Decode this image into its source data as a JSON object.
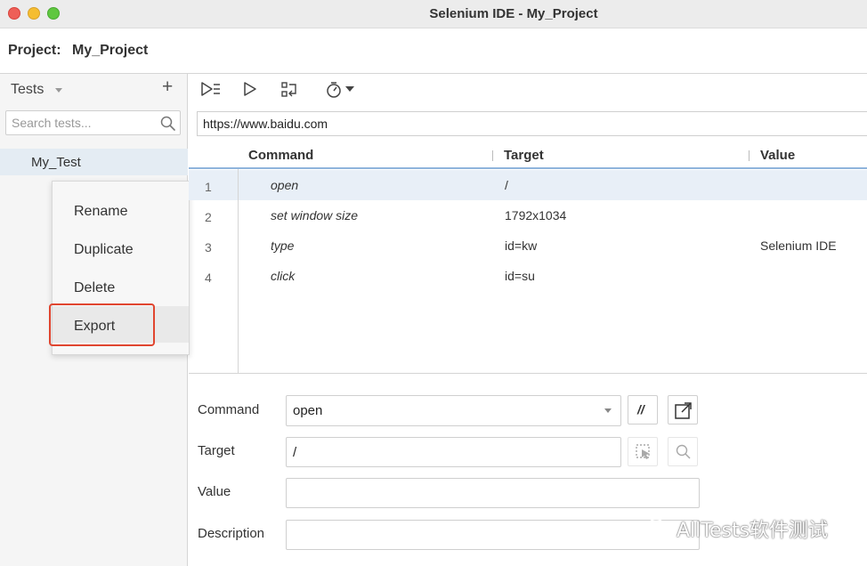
{
  "window": {
    "title": "Selenium IDE - My_Project"
  },
  "project": {
    "label": "Project:",
    "name": "My_Project"
  },
  "sidebar": {
    "title": "Tests",
    "search_placeholder": "Search tests...",
    "tests": [
      {
        "name": "My_Test"
      }
    ]
  },
  "context_menu": {
    "items": [
      "Rename",
      "Duplicate",
      "Delete",
      "Export"
    ],
    "highlighted": "Export"
  },
  "toolbar": {
    "icons": [
      "run-all-tests-icon",
      "run-current-test-icon",
      "step-over-icon",
      "test-execution-speed-icon"
    ]
  },
  "url": {
    "value": "https://www.baidu.com"
  },
  "table": {
    "headers": {
      "command": "Command",
      "target": "Target",
      "value": "Value"
    },
    "rows": [
      {
        "num": "1",
        "command": "open",
        "target": "/",
        "value": ""
      },
      {
        "num": "2",
        "command": "set window size",
        "target": "1792x1034",
        "value": ""
      },
      {
        "num": "3",
        "command": "type",
        "target": "id=kw",
        "value": "Selenium IDE"
      },
      {
        "num": "4",
        "command": "click",
        "target": "id=su",
        "value": ""
      }
    ],
    "selected_row": 1
  },
  "editor": {
    "command_label": "Command",
    "command_value": "open",
    "comment_button": "//",
    "target_label": "Target",
    "target_value": "/",
    "value_label": "Value",
    "value_value": "",
    "description_label": "Description",
    "description_value": ""
  },
  "watermark": {
    "text": "AllTests软件测试"
  },
  "colors": {
    "selection": "#e8eff7",
    "highlight_border": "#e0452f",
    "header_underline": "#8fb4dc"
  }
}
